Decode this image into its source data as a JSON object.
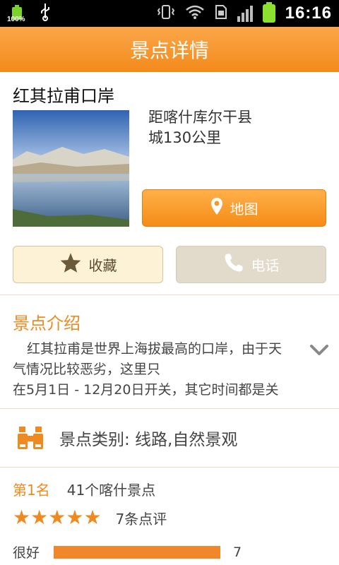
{
  "statusbar": {
    "battery_pct": "100%",
    "time": "16:16"
  },
  "titlebar": {
    "title": "景点详情"
  },
  "place": {
    "name": "红其拉甫口岸",
    "distance_line1": "距喀什库尔干县",
    "distance_line2": "城130公里"
  },
  "buttons": {
    "map": "地图",
    "favorite": "收藏",
    "phone": "电话"
  },
  "intro": {
    "title": "景点介绍",
    "line1": "红其拉甫是世界上海拔最高的口岸，由于天",
    "line2": "气情况比较恶劣，这里只",
    "line3": "在5月1日 - 12月20日开关，其它时间都是关"
  },
  "category": {
    "text": "景点类别: 线路,自然景观"
  },
  "ranking": {
    "rank": "第1名",
    "desc": "41个喀什景点",
    "stars": 5,
    "reviews": "7条点评",
    "rating_label": "很好",
    "rating_count": "7",
    "rating_fraction": 1.0
  },
  "colors": {
    "accent": "#f38a1a",
    "text_orange": "#ee8a20"
  },
  "icons": {
    "map_button": "map-pin-icon",
    "favorite_button": "star-icon",
    "phone_button": "phone-icon",
    "category": "binoculars-icon",
    "expand": "chevron-down-icon"
  }
}
